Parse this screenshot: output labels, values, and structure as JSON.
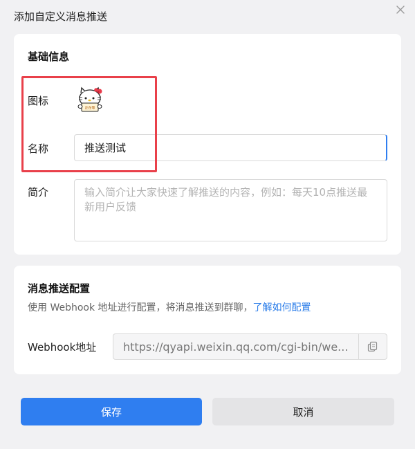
{
  "dialog": {
    "title": "添加自定义消息推送",
    "close_icon": "close-icon"
  },
  "basic_info": {
    "section_title": "基础信息",
    "icon_label": "图标",
    "icon_name": "hello-kitty-avatar",
    "avatar_tag": "正在等",
    "name_label": "名称",
    "name_value": "推送测试",
    "intro_label": "简介",
    "intro_placeholder": "输入简介让大家快速了解推送的内容，例如：每天10点推送最新用户反馈"
  },
  "push_config": {
    "section_title": "消息推送配置",
    "description": "使用 Webhook 地址进行配置，将消息推送到群聊，",
    "help_link": "了解如何配置",
    "webhook_label": "Webhook地址",
    "webhook_value": "https://qyapi.weixin.qq.com/cgi-bin/we...",
    "copy_icon": "copy-icon"
  },
  "actions": {
    "save_label": "保存",
    "cancel_label": "取消"
  },
  "colors": {
    "primary": "#2f7ef0",
    "highlight_box": "#e9404a",
    "link": "#2b7de9"
  }
}
